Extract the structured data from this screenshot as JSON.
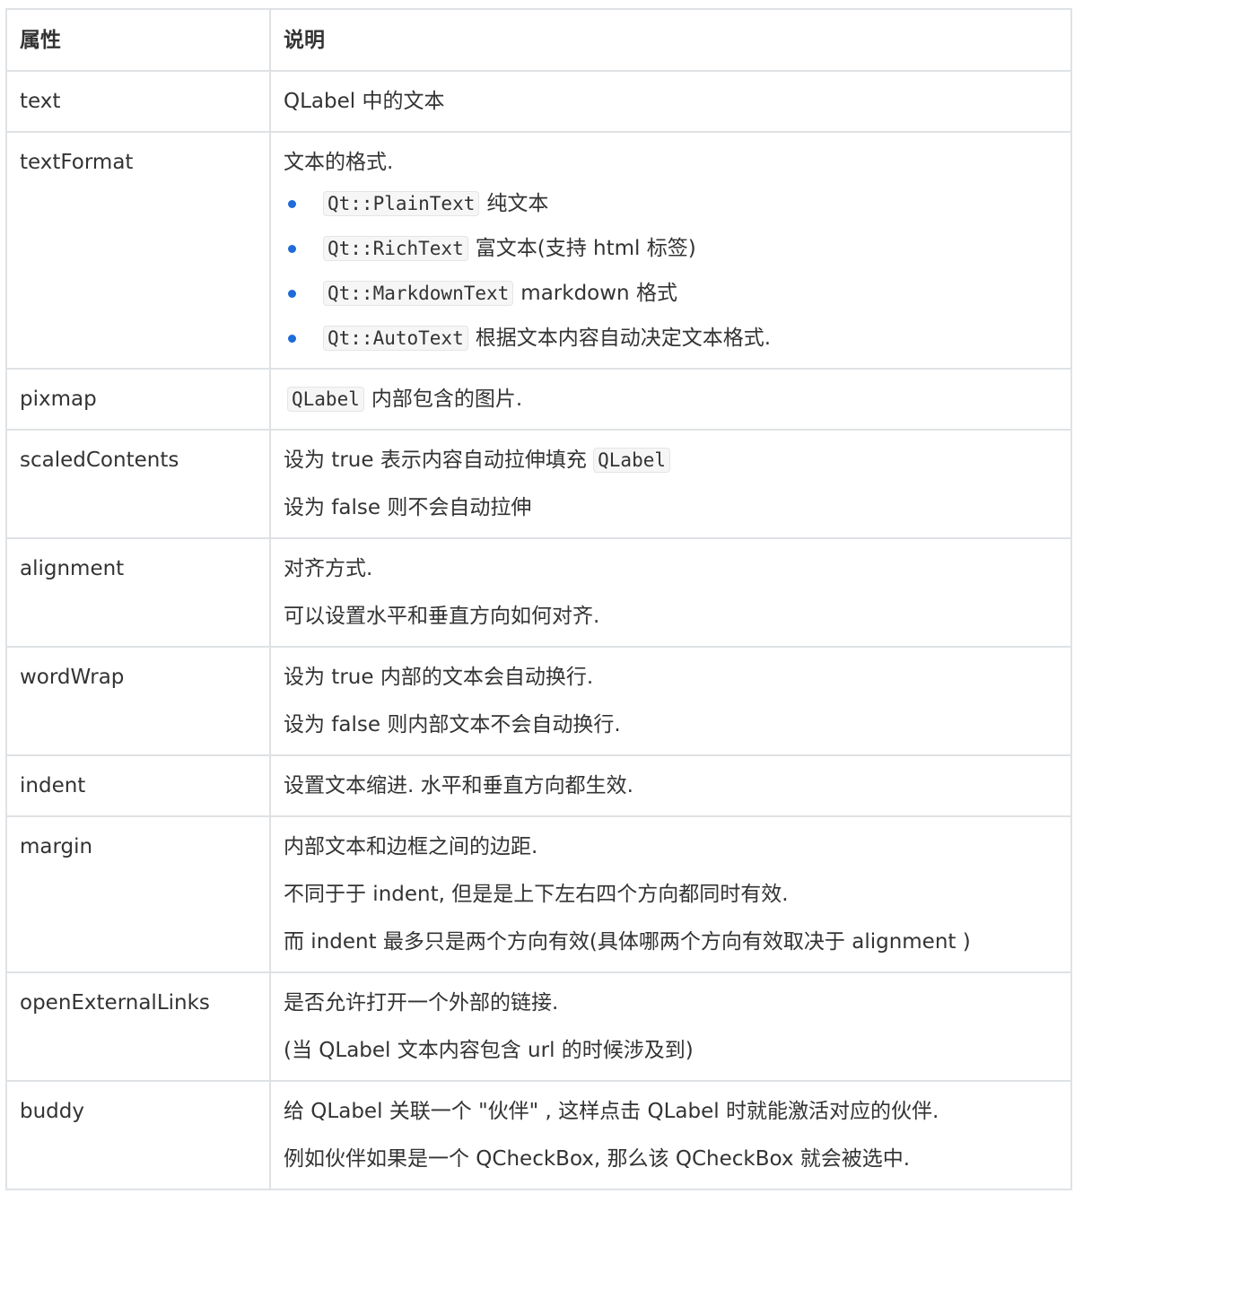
{
  "header": {
    "col_property": "属性",
    "col_description": "说明"
  },
  "rows": [
    {
      "property": "text",
      "lines": [
        "QLabel 中的文本"
      ]
    },
    {
      "property": "textFormat",
      "lines": [
        "文本的格式."
      ],
      "bullets": [
        {
          "code": "Qt::PlainText",
          "text": "纯文本"
        },
        {
          "code": "Qt::RichText",
          "text": "富文本(支持 html 标签)"
        },
        {
          "code": "Qt::MarkdownText",
          "text": "markdown 格式"
        },
        {
          "code": "Qt::AutoText",
          "text": "根据文本内容自动决定文本格式."
        }
      ]
    },
    {
      "property": "pixmap",
      "code": "QLabel",
      "text": "内部包含的图片."
    },
    {
      "property": "scaledContents",
      "line1_text": "设为 true 表示内容自动拉伸填充",
      "line1_code": "QLabel",
      "line2": "设为 false 则不会自动拉伸"
    },
    {
      "property": "alignment",
      "lines": [
        "对齐方式.",
        "可以设置水平和垂直方向如何对齐."
      ]
    },
    {
      "property": "wordWrap",
      "lines": [
        "设为 true 内部的文本会自动换行.",
        "设为 false 则内部文本不会自动换行."
      ]
    },
    {
      "property": "indent",
      "lines": [
        "设置文本缩进. 水平和垂直方向都生效."
      ]
    },
    {
      "property": "margin",
      "lines": [
        "内部文本和边框之间的边距.",
        "不同于于 indent, 但是是上下左右四个方向都同时有效.",
        "而 indent 最多只是两个方向有效(具体哪两个方向有效取决于  alignment )"
      ]
    },
    {
      "property": "openExternalLinks",
      "lines": [
        "是否允许打开一个外部的链接.",
        "(当 QLabel 文本内容包含 url 的时候涉及到)"
      ]
    },
    {
      "property": "buddy",
      "lines": [
        "给 QLabel 关联一个 \"伙伴\" , 这样点击 QLabel 时就能激活对应的伙伴.",
        "例如伙伴如果是一个 QCheckBox, 那么该 QCheckBox 就会被选中."
      ]
    }
  ]
}
